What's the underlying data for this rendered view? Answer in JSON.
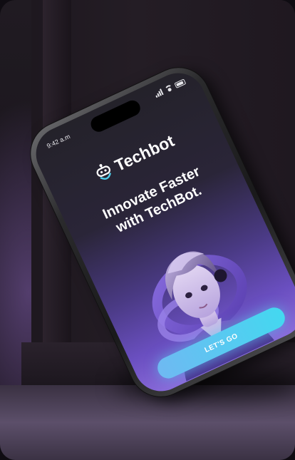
{
  "status_bar": {
    "time": "9:42 a.m",
    "icons": [
      "signal-icon",
      "wifi-icon",
      "battery-icon"
    ]
  },
  "app": {
    "brand": "Techbot",
    "logo_icon": "robot-icon",
    "headline_line1": "Innovate Faster",
    "headline_line2": "with TechBot.",
    "hero_image": "avatar-illustration",
    "cta_label": "LET'S GO"
  },
  "colors": {
    "accent": "#43d8f0",
    "screen_gradient_top": "#24222a",
    "screen_gradient_bottom": "#8a6bda"
  }
}
